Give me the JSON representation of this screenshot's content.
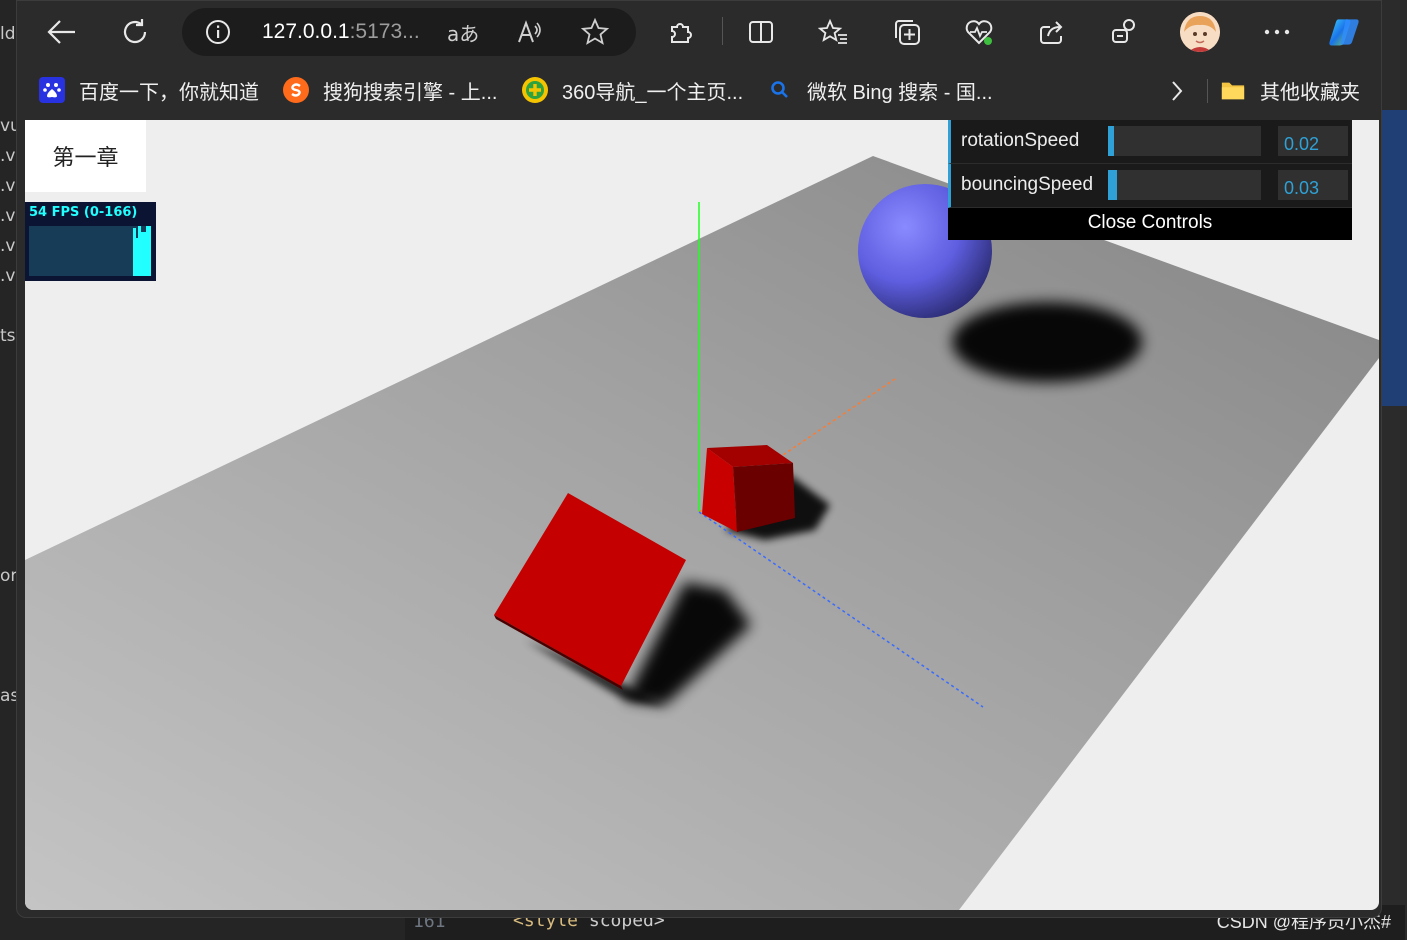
{
  "browser": {
    "url_host": "127.0.0.1",
    "url_rest": ":5173...",
    "read_aloud_glyph": "aあ"
  },
  "bookmarks": [
    {
      "label": "百度一下，你就知道",
      "icon": "baidu-icon",
      "color": "#2932e1"
    },
    {
      "label": "搜狗搜索引擎 - 上...",
      "icon": "sogou-icon",
      "color": "#ff6a1b"
    },
    {
      "label": "360导航_一个主页...",
      "icon": "360-icon",
      "color": "#2ea23f"
    },
    {
      "label": "微软 Bing 搜索 - 国...",
      "icon": "bing-search-icon",
      "color": "#1a73e8"
    }
  ],
  "other_favorites": "其他收藏夹",
  "page": {
    "chapter_label": "第一章",
    "fps_label": "54 FPS (0-166)"
  },
  "gui": {
    "controls": [
      {
        "name": "rotationSpeed",
        "value": "0.02",
        "fraction": 0.04
      },
      {
        "name": "bouncingSpeed",
        "value": "0.03",
        "fraction": 0.06
      }
    ],
    "close_label": "Close Controls",
    "accent": "#2fa1d6"
  },
  "editor": {
    "line_number": "161",
    "code_tag": "<style",
    "code_attr": " scoped>"
  },
  "watermark": "CSDN @程序员小杰#"
}
